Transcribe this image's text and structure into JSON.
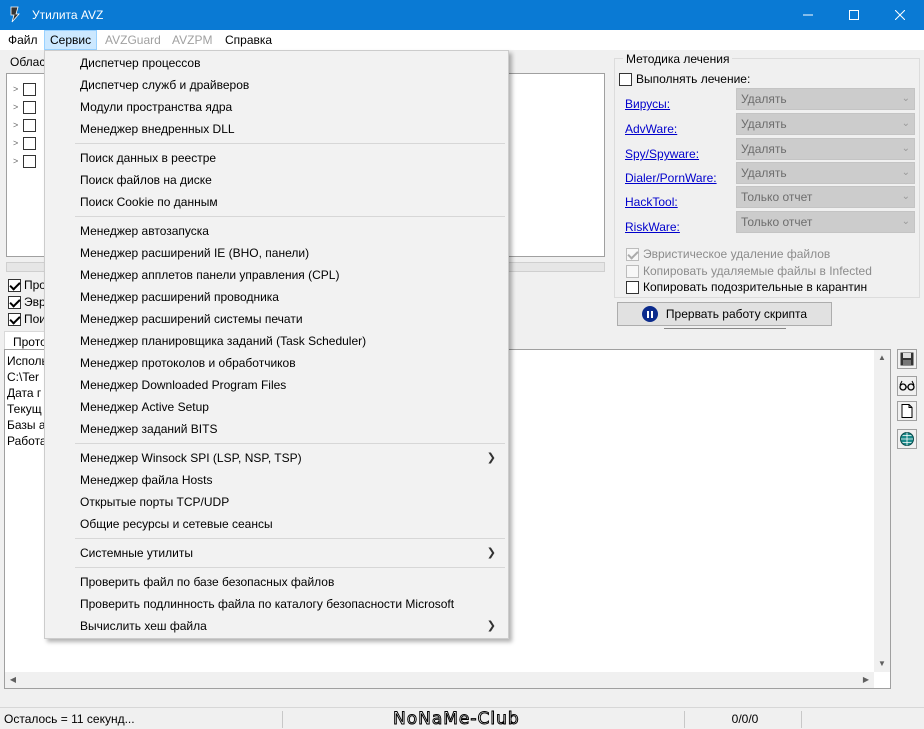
{
  "window": {
    "title": "Утилита AVZ"
  },
  "menubar": {
    "file": "Файл",
    "service": "Сервис",
    "avzguard": "AVZGuard",
    "avzpm": "AVZPM",
    "help": "Справка"
  },
  "left": {
    "scan_area_title": "Облас",
    "options": [
      "Про",
      "Эвр",
      "Пои"
    ]
  },
  "treatment": {
    "title": "Методика лечения",
    "perform_label": "Выполнять лечение:",
    "rows": [
      {
        "label": "Вирусы:",
        "value": "Удалять"
      },
      {
        "label": "AdvWare:",
        "value": "Удалять"
      },
      {
        "label": "Spy/Spyware:",
        "value": "Удалять"
      },
      {
        "label": "Dialer/PornWare:",
        "value": "Удалять"
      },
      {
        "label": "HackTool:",
        "value": "Только отчет"
      },
      {
        "label": "RiskWare:",
        "value": "Только отчет"
      }
    ],
    "heuristic_delete": "Эвристическое удаление файлов",
    "copy_deleted": "Копировать удаляемые файлы в  Infected",
    "copy_suspicious": "Копировать подозрительные в  карантин"
  },
  "abort_button": "Прервать работу скрипта",
  "log": {
    "tab": "Прото",
    "lines": [
      "Исполь",
      "C:\\Ter",
      "Дата г",
      "Текущ",
      "Базы а",
      "Работа"
    ]
  },
  "status": {
    "remaining": "Осталось = 11 секунд...",
    "counter": "0/0/0",
    "watermark": "NoNaMe-Club"
  },
  "menu": {
    "items": [
      "Диспетчер процессов",
      "Диспетчер служб и драйверов",
      "Модули пространства ядра",
      "Менеджер внедренных DLL",
      "Поиск данных  в реестре",
      "Поиск файлов на диске",
      "Поиск Cookie по данным",
      "Менеджер автозапуска",
      "Менеджер расширений IE (BHO, панели)",
      "Менеджер апплетов панели управления (CPL)",
      "Менеджер расширений проводника",
      "Менеджер расширений системы печати",
      "Менеджер планировщика заданий (Task Scheduler)",
      "Менеджер протоколов и обработчиков",
      "Менеджер Downloaded Program Files",
      "Менеджер Active Setup",
      "Менеджер заданий BITS",
      "Менеджер Winsock SPI (LSP, NSP, TSP)",
      "Менеджер файла Hosts",
      "Открытые порты TCP/UDP",
      "Общие ресурсы и сетевые сеансы",
      "Системные утилиты",
      "Проверить файл по базе безопасных файлов",
      "Проверить подлинность файла по каталогу безопасности Microsoft",
      "Вычислить хеш файла"
    ]
  },
  "colors": {
    "titlebar": "#0a7ad4",
    "menu_active": "#cce8ff",
    "link": "#0000cc"
  }
}
